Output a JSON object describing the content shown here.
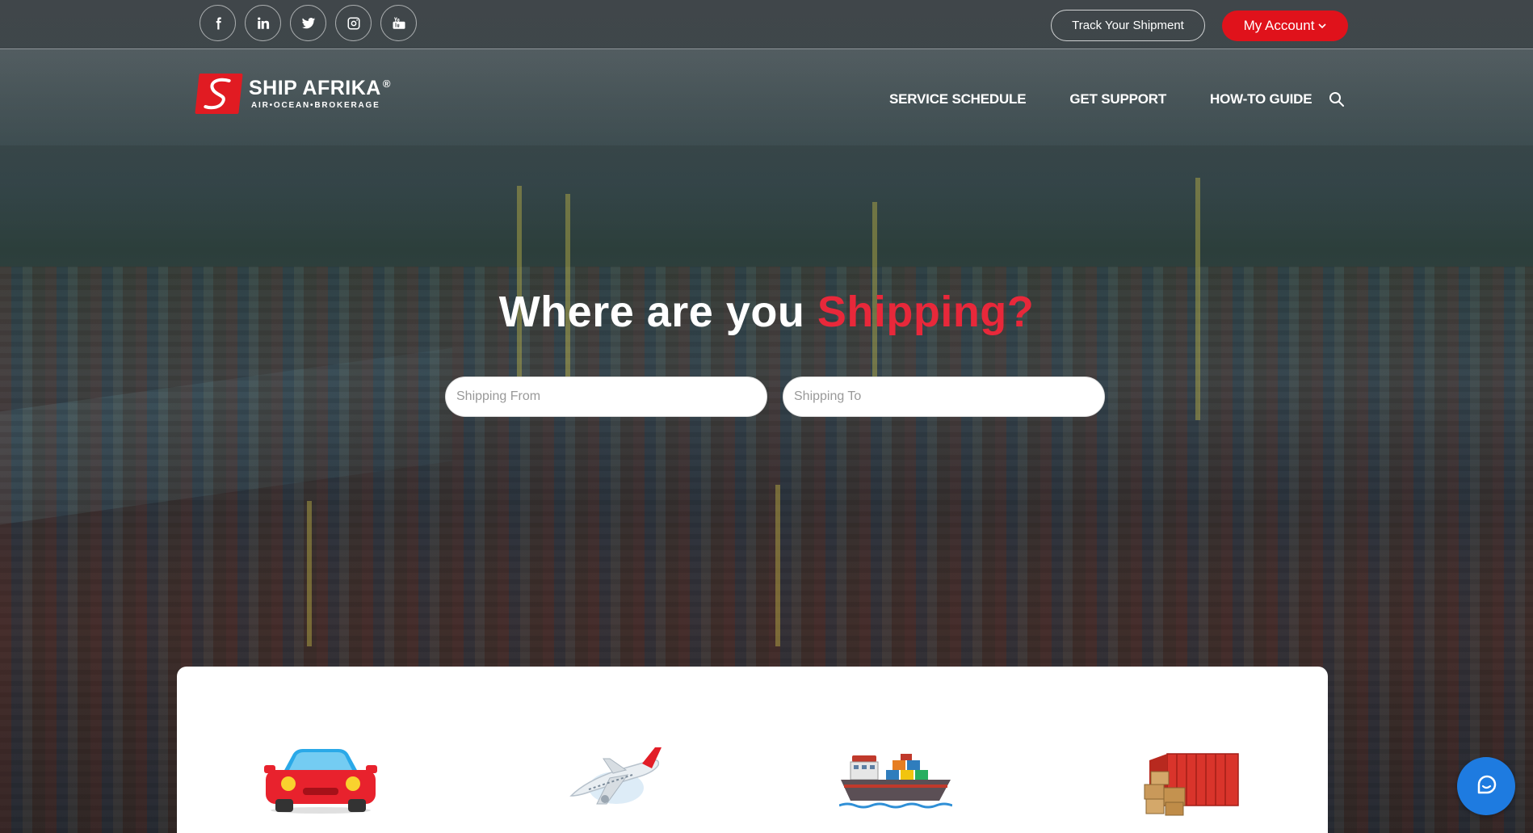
{
  "topbar": {
    "social": [
      {
        "name": "facebook-icon",
        "glyph": "f"
      },
      {
        "name": "linkedin-icon",
        "glyph": "in"
      },
      {
        "name": "twitter-icon",
        "glyph": ""
      },
      {
        "name": "instagram-icon",
        "glyph": ""
      },
      {
        "name": "youtube-icon",
        "glyph": ""
      }
    ],
    "track_label": "Track Your Shipment",
    "account_label": "My Account"
  },
  "logo": {
    "name": "SHIP AFRIKA",
    "reg": "®",
    "tagline": "AIR•OCEAN•BROKERAGE"
  },
  "nav": {
    "items": [
      "SERVICE SCHEDULE",
      "GET SUPPORT",
      "HOW-TO GUIDE"
    ]
  },
  "hero": {
    "title_main": "Where are you ",
    "title_accent": "Shipping?",
    "from_placeholder": "Shipping From",
    "to_placeholder": "Shipping To"
  },
  "services": [
    {
      "icon": "car-icon"
    },
    {
      "icon": "airplane-icon"
    },
    {
      "icon": "cargo-ship-icon"
    },
    {
      "icon": "shipping-container-icon"
    }
  ],
  "colors": {
    "accent_red": "#e0121b",
    "title_accent": "#e8283a",
    "chat_blue": "#1e7be0"
  }
}
